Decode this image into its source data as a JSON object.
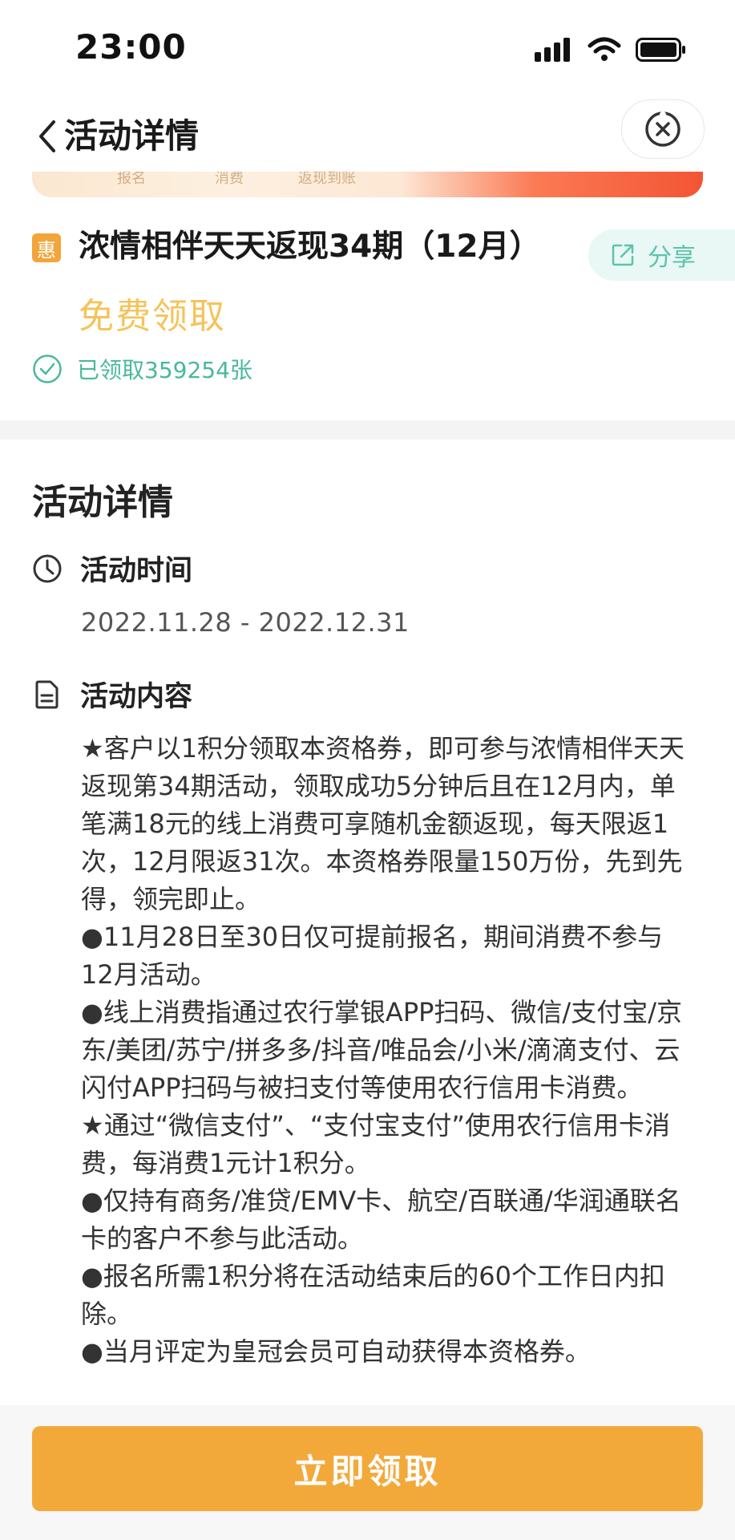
{
  "status_bar": {
    "time": "23:00"
  },
  "nav": {
    "title": "活动详情"
  },
  "banner": {
    "labels": [
      "报名",
      "消费",
      "返现到账"
    ]
  },
  "coupon": {
    "badge": "惠",
    "title": "浓情相伴天天返现34期（12月）",
    "price_label": "免费领取",
    "claimed_text": "已领取359254张",
    "share_label": "分享"
  },
  "details": {
    "section_title": "活动详情",
    "time_label": "活动时间",
    "time_value": "2022.11.28 - 2022.12.31",
    "content_label": "活动内容",
    "content_paragraphs": [
      "★客户以1积分领取本资格券，即可参与浓情相伴天天返现第34期活动，领取成功5分钟后且在12月内，单笔满18元的线上消费可享随机金额返现，每天限返1次，12月限返31次。本资格券限量150万份，先到先得，领完即止。",
      "●11月28日至30日仅可提前报名，期间消费不参与12月活动。",
      "●线上消费指通过农行掌银APP扫码、微信/支付宝/京东/美团/苏宁/拼多多/抖音/唯品会/小米/滴滴支付、云闪付APP扫码与被扫支付等使用农行信用卡消费。",
      "★通过“微信支付”、“支付宝支付”使用农行信用卡消费，每消费1元计1积分。",
      "●仅持有商务/准贷/EMV卡、航空/百联通/华润通联名卡的客户不参与此活动。",
      "●报名所需1积分将在活动结束后的60个工作日内扣除。",
      "●当月评定为皇冠会员可自动获得本资格券。"
    ]
  },
  "footer": {
    "button_label": "立即领取"
  },
  "colors": {
    "accent_orange": "#F3A93A",
    "free_text": "#F4C45A",
    "green": "#48B89C"
  }
}
